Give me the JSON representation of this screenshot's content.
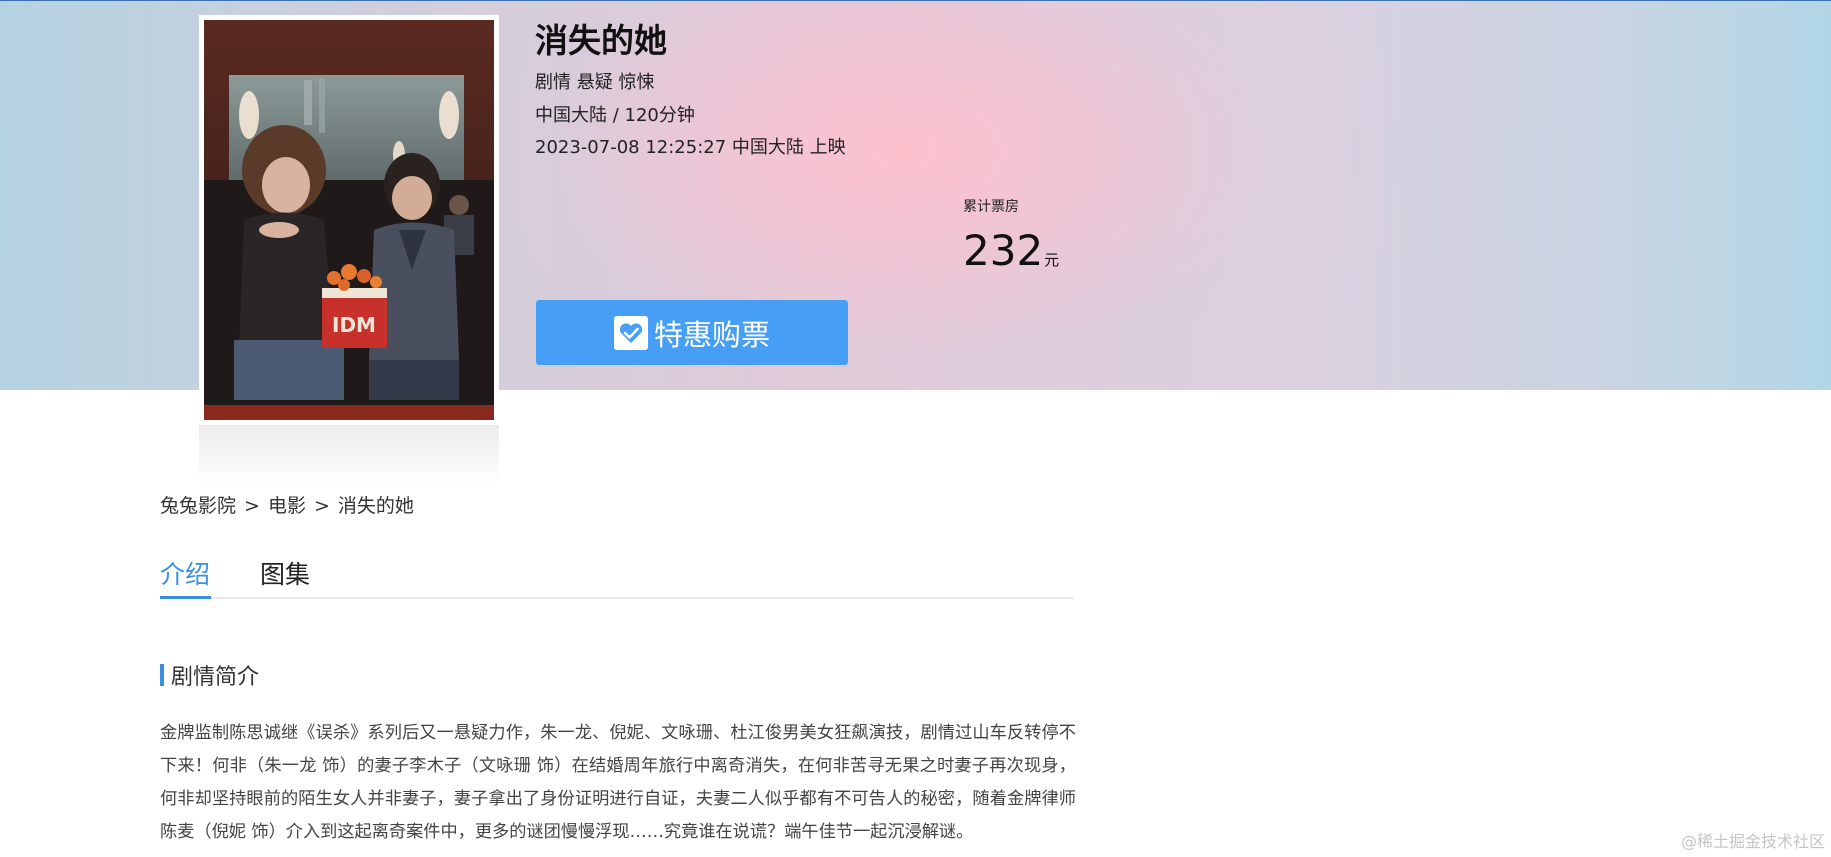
{
  "movie": {
    "title": "消失的她",
    "genres": "剧情 悬疑 惊悚",
    "region_duration": "中国大陆 / 120分钟",
    "release": "2023-07-08 12:25:27 中国大陆 上映",
    "poster_icon": "movie-poster-image"
  },
  "box_office": {
    "label": "累计票房",
    "value": "232",
    "unit": "元"
  },
  "buy_button": {
    "label": "特惠购票",
    "icon": "check-heart-icon"
  },
  "breadcrumb": {
    "items": [
      "兔兔影院",
      "电影",
      "消失的她"
    ],
    "separator": ">"
  },
  "tabs": [
    {
      "label": "介绍",
      "active": true
    },
    {
      "label": "图集",
      "active": false
    }
  ],
  "synopsis": {
    "heading": "剧情简介",
    "text": "金牌监制陈思诚继《误杀》系列后又一悬疑力作，朱一龙、倪妮、文咏珊、杜江俊男美女狂飙演技，剧情过山车反转停不下来！何非（朱一龙 饰）的妻子李木子（文咏珊 饰）在结婚周年旅行中离奇消失，在何非苦寻无果之时妻子再次现身，何非却坚持眼前的陌生女人并非妻子，妻子拿出了身份证明进行自证，夫妻二人似乎都有不可告人的秘密，随着金牌律师陈麦（倪妮 饰）介入到这起离奇案件中，更多的谜团慢慢浮现……究竟谁在说谎？端午佳节一起沉浸解谜。"
  },
  "watermark": "@稀土掘金技术社区",
  "colors": {
    "accent": "#3b8fe0",
    "button": "#469ff4"
  }
}
